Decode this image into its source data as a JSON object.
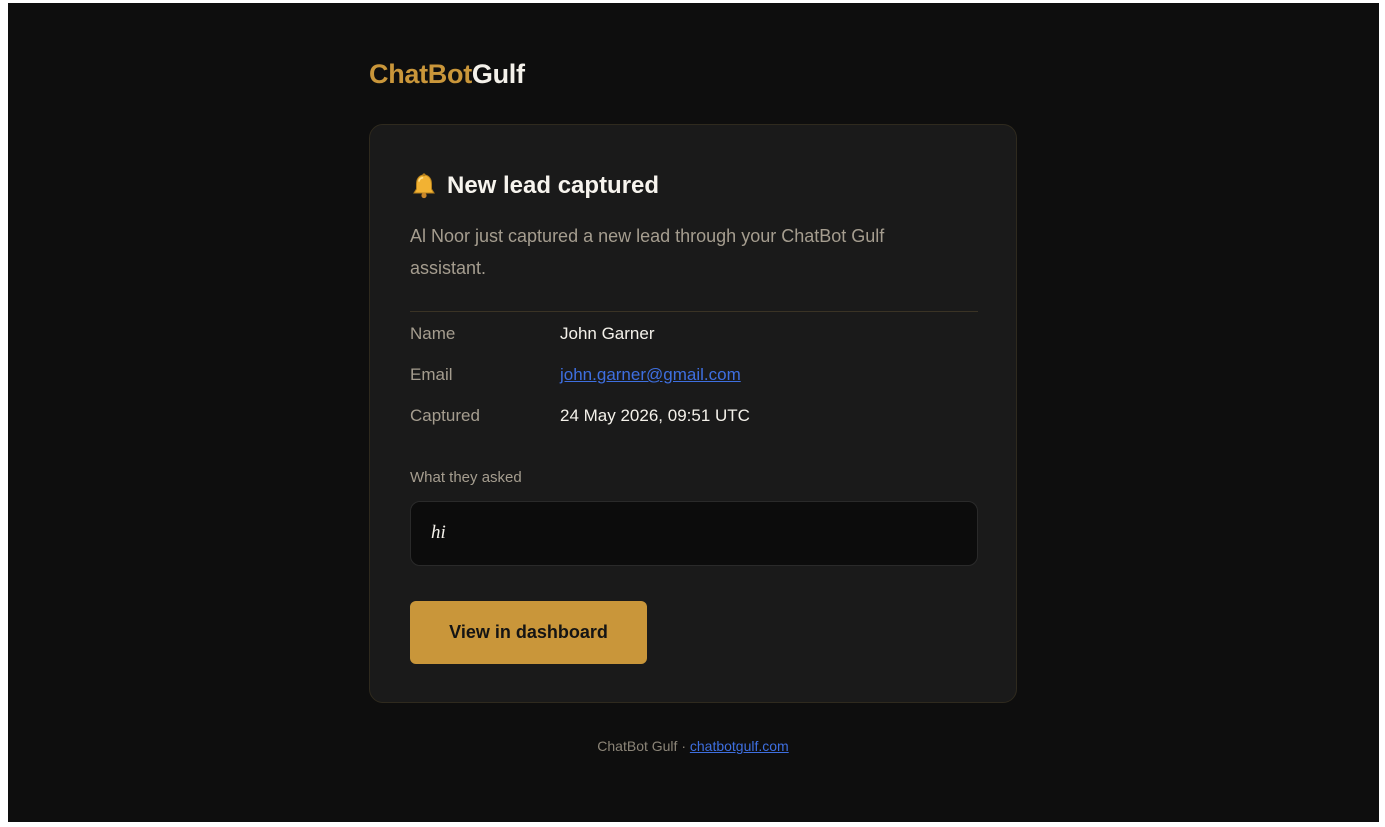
{
  "brand": {
    "part1": "ChatBot",
    "part2": "Gulf"
  },
  "colors": {
    "accent": "#c9963a",
    "background": "#0e0e0e",
    "card": "#1a1a1a",
    "link": "#3e6fe0"
  },
  "card": {
    "icon": "bell-icon",
    "title": "New lead captured",
    "intro": "Al Noor just captured a new lead through your ChatBot Gulf assistant.",
    "fields": [
      {
        "label": "Name",
        "value": "John Garner"
      },
      {
        "label": "Email",
        "value": "john.garner@gmail.com"
      },
      {
        "label": "Captured",
        "value": "24 May 2026, 09:51 UTC"
      }
    ],
    "asked_label": "What they asked",
    "asked_text": "hi",
    "cta_label": "View in dashboard"
  },
  "footer": {
    "text": "ChatBot Gulf · ",
    "link": "chatbotgulf.com"
  }
}
